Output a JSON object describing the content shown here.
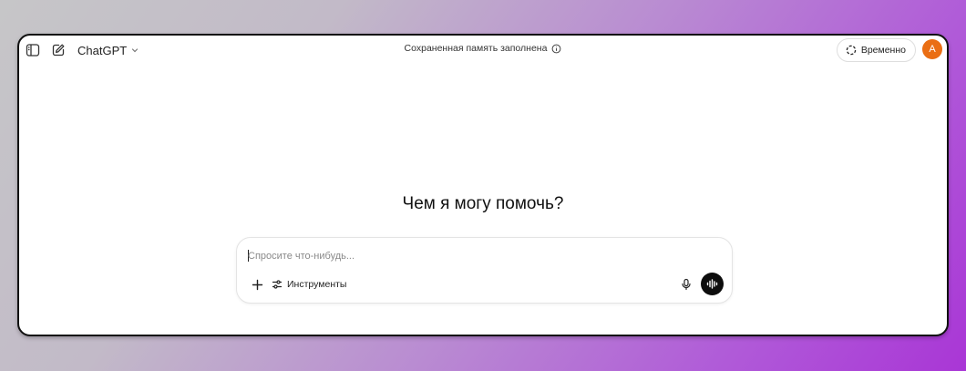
{
  "header": {
    "model_name": "ChatGPT",
    "memory_notice": "Сохраненная память заполнена",
    "temporary_label": "Временно",
    "avatar_initial": "A"
  },
  "main": {
    "headline": "Чем я могу помочь?"
  },
  "composer": {
    "placeholder": "Спросите что-нибудь...",
    "value": "",
    "tools_label": "Инструменты"
  },
  "icons": {
    "sidebar_toggle": "sidebar-toggle-icon",
    "new_chat": "edit-icon",
    "model_dropdown": "chevron-down-icon",
    "memory_info": "info-icon",
    "temporary": "dashed-circle-icon",
    "attach": "plus-icon",
    "tools": "sliders-icon",
    "mic": "mic-icon",
    "voice": "waveform-icon"
  },
  "colors": {
    "avatar": "#ea6e14",
    "voice_button": "#0d0d0d",
    "background_gradient_end": "#a936d6"
  }
}
